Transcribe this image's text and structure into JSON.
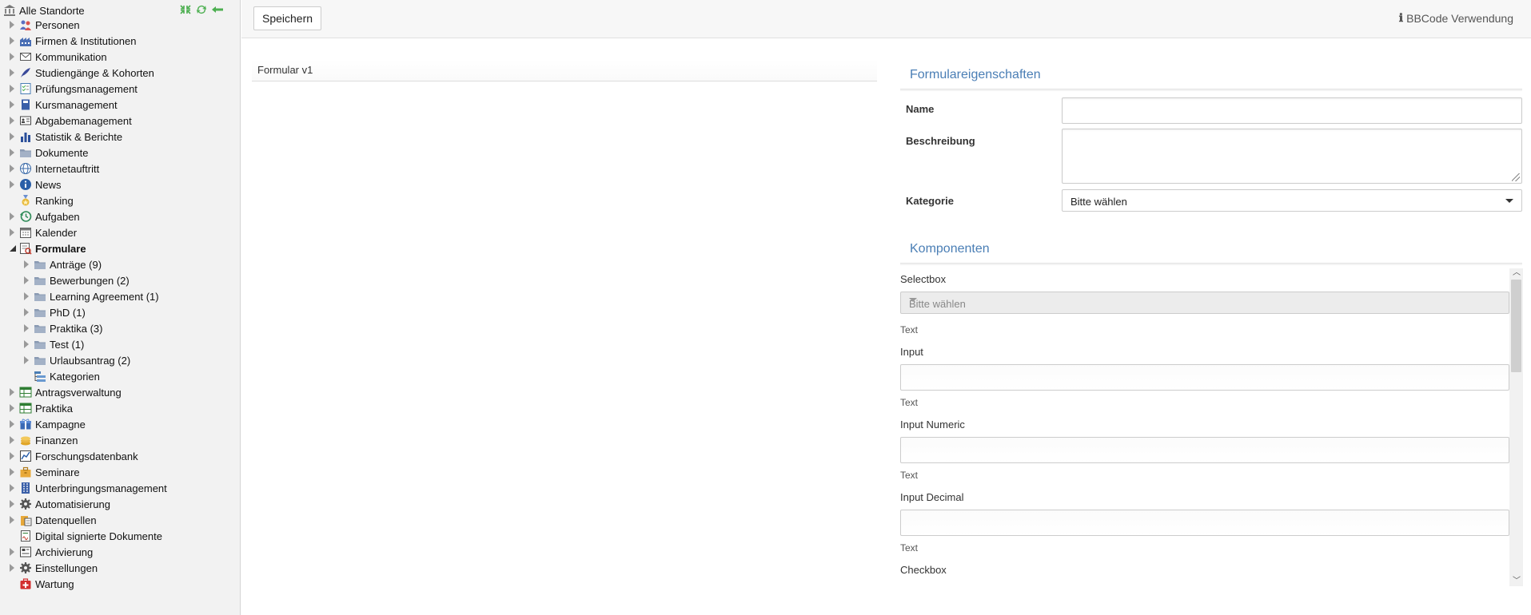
{
  "sidebar": {
    "root_label": "Alle Standorte",
    "items": [
      {
        "label": "Personen",
        "icon": "people-icon",
        "arrow": "closed",
        "level": 1
      },
      {
        "label": "Firmen & Institutionen",
        "icon": "factory-icon",
        "arrow": "closed",
        "level": 1
      },
      {
        "label": "Kommunikation",
        "icon": "envelope-icon",
        "arrow": "closed",
        "level": 1
      },
      {
        "label": "Studiengänge & Kohorten",
        "icon": "feather-icon",
        "arrow": "closed",
        "level": 1
      },
      {
        "label": "Prüfungsmanagement",
        "icon": "checklist-icon",
        "arrow": "closed",
        "level": 1
      },
      {
        "label": "Kursmanagement",
        "icon": "book-icon",
        "arrow": "closed",
        "level": 1
      },
      {
        "label": "Abgabemanagement",
        "icon": "id-card-icon",
        "arrow": "closed",
        "level": 1
      },
      {
        "label": "Statistik & Berichte",
        "icon": "bar-chart-icon",
        "arrow": "closed",
        "level": 1
      },
      {
        "label": "Dokumente",
        "icon": "folder-icon",
        "arrow": "closed",
        "level": 1
      },
      {
        "label": "Internetauftritt",
        "icon": "globe-icon",
        "arrow": "closed",
        "level": 1
      },
      {
        "label": "News",
        "icon": "info-icon",
        "arrow": "closed",
        "level": 1
      },
      {
        "label": "Ranking",
        "icon": "medal-icon",
        "arrow": "none",
        "level": 1
      },
      {
        "label": "Aufgaben",
        "icon": "history-icon",
        "arrow": "closed",
        "level": 1
      },
      {
        "label": "Kalender",
        "icon": "calendar-icon",
        "arrow": "closed",
        "level": 1
      },
      {
        "label": "Formulare",
        "icon": "form-icon",
        "arrow": "open",
        "level": 1,
        "bold": true
      },
      {
        "label": "Anträge (9)",
        "icon": "folder-icon",
        "arrow": "closed",
        "level": 2
      },
      {
        "label": "Bewerbungen (2)",
        "icon": "folder-icon",
        "arrow": "closed",
        "level": 2
      },
      {
        "label": "Learning Agreement (1)",
        "icon": "folder-icon",
        "arrow": "closed",
        "level": 2
      },
      {
        "label": "PhD (1)",
        "icon": "folder-icon",
        "arrow": "closed",
        "level": 2
      },
      {
        "label": "Praktika (3)",
        "icon": "folder-icon",
        "arrow": "closed",
        "level": 2
      },
      {
        "label": "Test (1)",
        "icon": "folder-icon",
        "arrow": "closed",
        "level": 2
      },
      {
        "label": "Urlaubsantrag (2)",
        "icon": "folder-icon",
        "arrow": "closed",
        "level": 2
      },
      {
        "label": "Kategorien",
        "icon": "category-icon",
        "arrow": "none",
        "level": 2
      },
      {
        "label": "Antragsverwaltung",
        "icon": "table-icon",
        "arrow": "closed",
        "level": 1
      },
      {
        "label": "Praktika",
        "icon": "table-icon",
        "arrow": "closed",
        "level": 1
      },
      {
        "label": "Kampagne",
        "icon": "gift-icon",
        "arrow": "closed",
        "level": 1
      },
      {
        "label": "Finanzen",
        "icon": "coins-icon",
        "arrow": "closed",
        "level": 1
      },
      {
        "label": "Forschungsdatenbank",
        "icon": "line-chart-icon",
        "arrow": "closed",
        "level": 1
      },
      {
        "label": "Seminare",
        "icon": "briefcase-icon",
        "arrow": "closed",
        "level": 1
      },
      {
        "label": "Unterbringungsmanagement",
        "icon": "building-icon",
        "arrow": "closed",
        "level": 1
      },
      {
        "label": "Automatisierung",
        "icon": "gear-icon",
        "arrow": "closed",
        "level": 1
      },
      {
        "label": "Datenquellen",
        "icon": "database-icon",
        "arrow": "closed",
        "level": 1
      },
      {
        "label": "Digital signierte Dokumente",
        "icon": "signed-doc-icon",
        "arrow": "none",
        "level": 1
      },
      {
        "label": "Archivierung",
        "icon": "archive-icon",
        "arrow": "closed",
        "level": 1
      },
      {
        "label": "Einstellungen",
        "icon": "gear-icon",
        "arrow": "closed",
        "level": 1
      },
      {
        "label": "Wartung",
        "icon": "first-aid-icon",
        "arrow": "none",
        "level": 1
      }
    ]
  },
  "toolbar": {
    "save_label": "Speichern",
    "bbcode_label": "BBCode Verwendung"
  },
  "form_preview": {
    "title": "Formular v1"
  },
  "properties": {
    "section_title": "Formulareigenschaften",
    "name_label": "Name",
    "name_value": "",
    "description_label": "Beschreibung",
    "description_value": "",
    "category_label": "Kategorie",
    "category_value": "Bitte wählen"
  },
  "components": {
    "section_title": "Komponenten",
    "selectbox_label": "Selectbox",
    "selectbox_value": "Bitte wählen",
    "text1": "Text",
    "input_label": "Input",
    "text2": "Text",
    "input_numeric_label": "Input Numeric",
    "text3": "Text",
    "input_decimal_label": "Input Decimal",
    "text4": "Text",
    "checkbox_label": "Checkbox"
  },
  "colors": {
    "accent": "#4a7eb5",
    "sidebar_bg": "#f2f2f2"
  }
}
